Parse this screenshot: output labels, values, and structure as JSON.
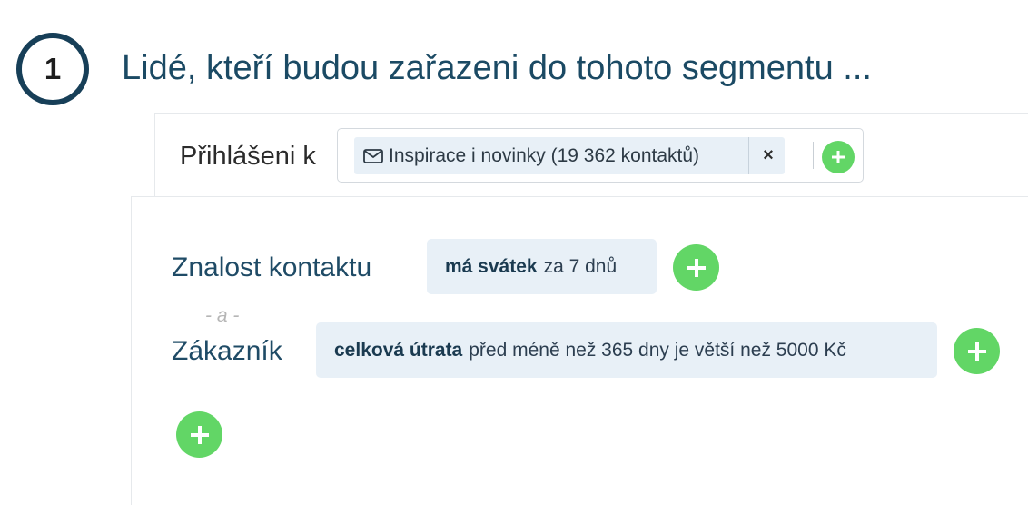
{
  "step": {
    "number": "1",
    "heading": "Lidé, kteří budou zařazeni do tohoto segmentu ..."
  },
  "subscription": {
    "label": "Přihlášeni k",
    "tag": {
      "icon": "envelope-icon",
      "text": "Inspirace i novinky (19 362 kontaktů)",
      "remove": "×"
    },
    "add_icon": "plus-icon"
  },
  "conditions": [
    {
      "label": "Znalost kontaktu",
      "bold": "má svátek",
      "rest": "za 7 dnů",
      "add_icon": "plus-icon"
    },
    {
      "label": "Zákazník",
      "bold": "celková útrata",
      "rest": "před méně než 365 dny je větší než 5000 Kč",
      "add_icon": "plus-icon"
    }
  ],
  "separator": "- a -",
  "add_group_icon": "plus-icon",
  "colors": {
    "accent_green": "#62d666",
    "chip_bg": "#e8f0f7",
    "step_ring": "#173f58",
    "heading": "#1b4a64"
  }
}
